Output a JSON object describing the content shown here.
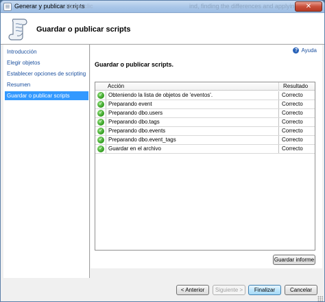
{
  "window": {
    "title": "Generar y publicar scripts",
    "ghost_title_left": "Hacer clic ",
    "ghost_title_right": "ind, finding the differences and applying m",
    "close_label": "✕"
  },
  "header": {
    "title": "Guardar o publicar scripts"
  },
  "sidebar": {
    "items": [
      {
        "label": "Introducción",
        "active": false
      },
      {
        "label": "Elegir objetos",
        "active": false
      },
      {
        "label": "Establecer opciones de scripting",
        "active": false
      },
      {
        "label": "Resumen",
        "active": false
      },
      {
        "label": "Guardar o publicar scripts",
        "active": true
      }
    ]
  },
  "main": {
    "help_label": "Ayuda",
    "section_title": "Guardar o publicar scripts.",
    "grid": {
      "columns": {
        "action": "Acción",
        "result": "Resultado"
      },
      "rows": [
        {
          "action": "Obteniendo la lista de objetos de 'eventos'.",
          "result": "Correcto",
          "status": "success"
        },
        {
          "action": "Preparando event",
          "result": "Correcto",
          "status": "success"
        },
        {
          "action": "Preparando dbo.users",
          "result": "Correcto",
          "status": "success"
        },
        {
          "action": "Preparando dbo.tags",
          "result": "Correcto",
          "status": "success"
        },
        {
          "action": "Preparando dbo.events",
          "result": "Correcto",
          "status": "success"
        },
        {
          "action": "Preparando dbo.event_tags",
          "result": "Correcto",
          "status": "success"
        },
        {
          "action": "Guardar en el archivo",
          "result": "Correcto",
          "status": "success"
        }
      ]
    },
    "save_report_label": "Guardar informe"
  },
  "footer": {
    "back_label": "< Anterior",
    "next_label": "Siguiente >",
    "finish_label": "Finalizar",
    "cancel_label": "Cancelar"
  },
  "colors": {
    "accent": "#3399ff",
    "link": "#1a4f9e",
    "success": "#2f9a1d"
  }
}
